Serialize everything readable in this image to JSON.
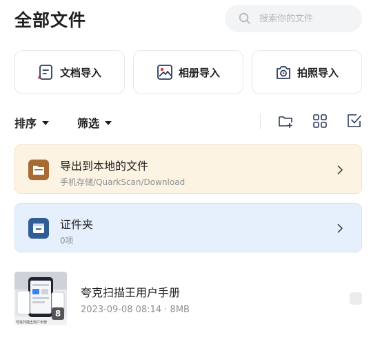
{
  "header": {
    "title": "全部文件"
  },
  "search": {
    "placeholder": "搜索你的文件",
    "icon": "search-icon"
  },
  "imports": [
    {
      "label": "文档导入",
      "icon": "document-icon"
    },
    {
      "label": "相册导入",
      "icon": "image-icon"
    },
    {
      "label": "拍照导入",
      "icon": "camera-icon"
    }
  ],
  "toolbar": {
    "sort_label": "排序",
    "filter_label": "筛选",
    "icons": [
      "new-folder-icon",
      "grid-view-icon",
      "select-icon"
    ]
  },
  "folders": [
    {
      "name": "导出到本地的文件",
      "subtitle": "手机存储/QuarkScan/Download",
      "icon": "folder-icon",
      "color": "#a86a35",
      "background": "#fdf3e2"
    },
    {
      "name": "证件夹",
      "subtitle": "0项",
      "icon": "id-card-icon",
      "color": "#2f5e97",
      "background": "#e6f0fc"
    }
  ],
  "files": [
    {
      "name": "夸克扫描王用户手册",
      "meta": "2023-09-08 08:14 · 8MB",
      "page_count": "8",
      "thumb_caption": "夸克扫描王用户手册"
    }
  ],
  "colors": {
    "accent": "#1f1f1f",
    "muted": "#8c8f94",
    "icon_red": "#e0434b",
    "icon_navy": "#2b3a5c"
  }
}
